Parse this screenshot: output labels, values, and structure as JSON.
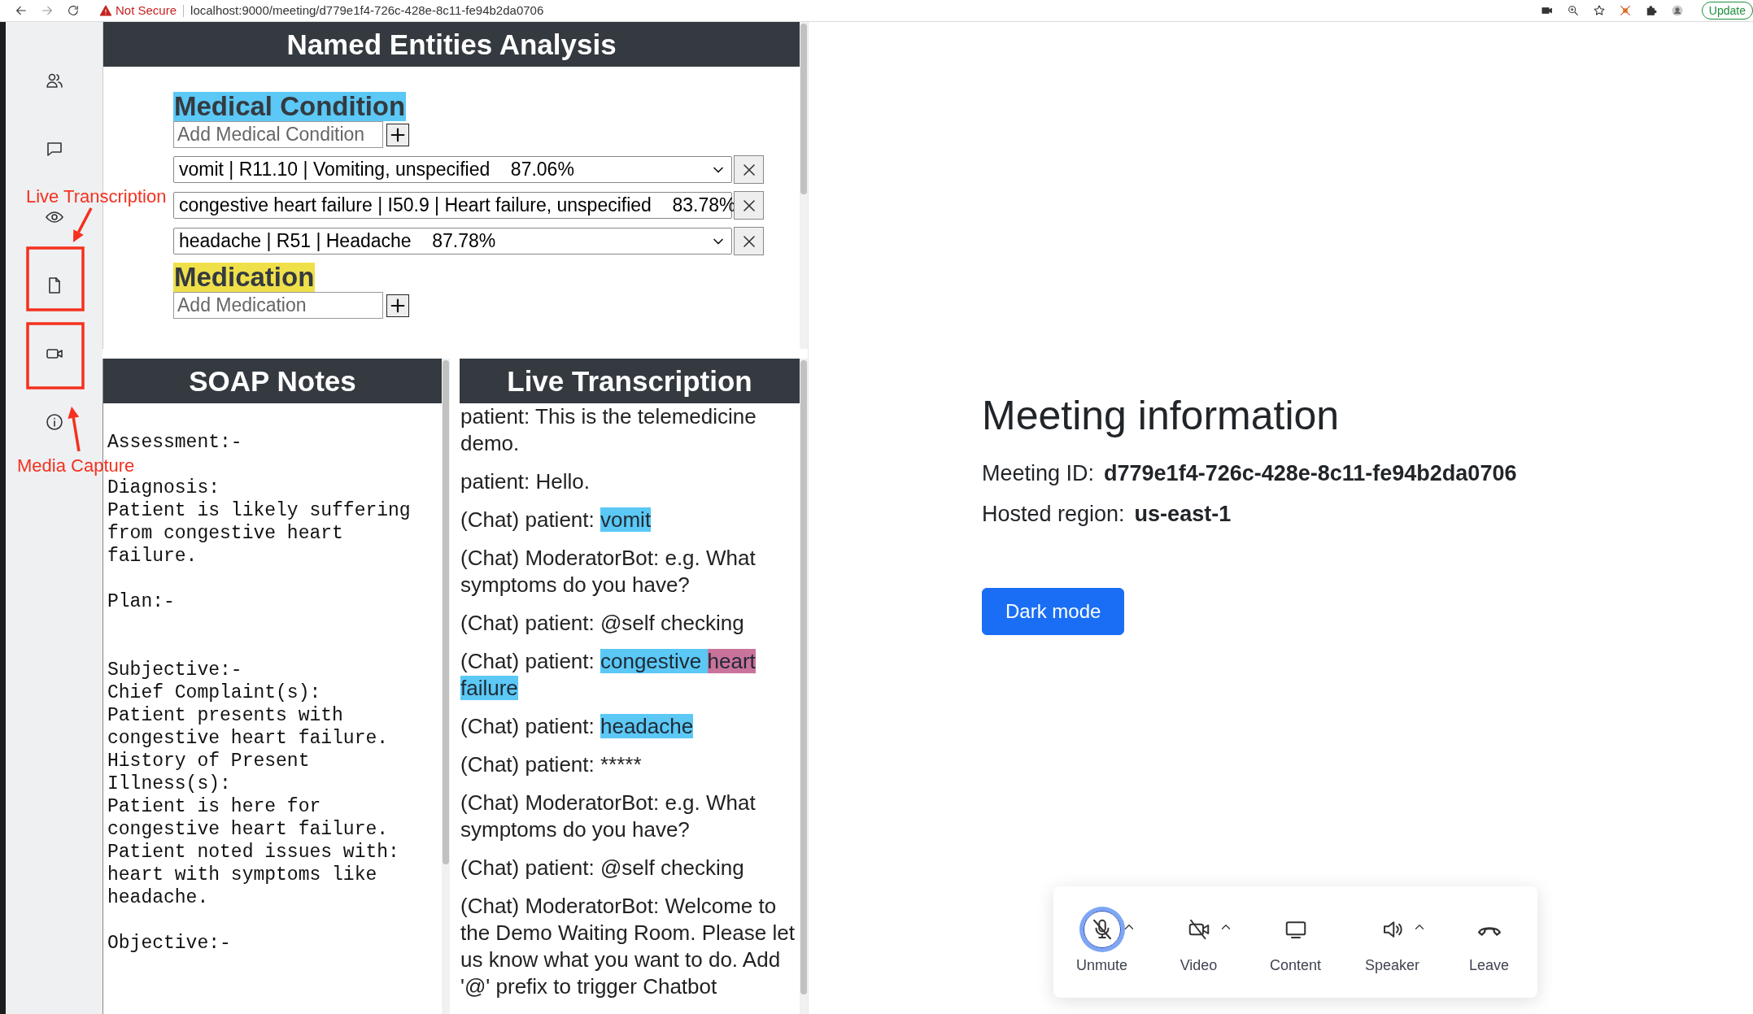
{
  "browser": {
    "security": "Not Secure",
    "url": "localhost:9000/meeting/d779e1f4-726c-428e-8c11-fe94b2da0706",
    "update_button": "Update"
  },
  "annotations": [
    {
      "label": "Live Transcription"
    },
    {
      "label": "Media Capture"
    }
  ],
  "entities": {
    "title": "Named Entities Analysis",
    "sections": [
      {
        "heading": "Medical Condition",
        "color": "#5bc8f5",
        "add_placeholder": "Add Medical Condition",
        "items": [
          {
            "text": "vomit | R11.10 | Vomiting, unspecified    87.06%"
          },
          {
            "text": "congestive heart failure | I50.9 | Heart failure, unspecified    83.78%"
          },
          {
            "text": "headache | R51 | Headache    87.78%"
          }
        ]
      },
      {
        "heading": "Medication",
        "color": "#efe04a",
        "add_placeholder": "Add Medication"
      }
    ]
  },
  "soap": {
    "title": "SOAP Notes",
    "blocks": [
      "Assessment:-",
      "Diagnosis:\nPatient is likely suffering from congestive heart failure.",
      "Plan:-\n\n",
      "Subjective:-\nChief Complaint(s):\nPatient presents with congestive heart failure.\nHistory of Present Illness(s):\nPatient is here for congestive heart failure.\nPatient noted issues with: heart with symptoms like headache.",
      "Objective:-"
    ]
  },
  "transcription": {
    "title": "Live Transcription",
    "messages": [
      {
        "segments": [
          {
            "text": "patient: This is the telemedicine demo."
          }
        ]
      },
      {
        "segments": [
          {
            "text": "patient: Hello."
          }
        ]
      },
      {
        "segments": [
          {
            "text": "(Chat) patient: "
          },
          {
            "text": "vomit",
            "color": "#5bc8f5"
          }
        ]
      },
      {
        "segments": [
          {
            "text": "(Chat) ModeratorBot: e.g. What symptoms do you have?"
          }
        ]
      },
      {
        "segments": [
          {
            "text": "(Chat) patient: @self checking"
          }
        ]
      },
      {
        "segments": [
          {
            "text": "(Chat) patient: "
          },
          {
            "text": "congestive ",
            "color": "#5bc8f5"
          },
          {
            "text": "heart",
            "color": "#c9739b"
          },
          {
            "text": " failure",
            "color": "#5bc8f5"
          }
        ]
      },
      {
        "segments": [
          {
            "text": "(Chat) patient: "
          },
          {
            "text": "headache",
            "color": "#5bc8f5"
          }
        ]
      },
      {
        "segments": [
          {
            "text": "(Chat) patient: *****"
          }
        ]
      },
      {
        "segments": [
          {
            "text": "(Chat) ModeratorBot: e.g. What symptoms do you have?"
          }
        ]
      },
      {
        "segments": [
          {
            "text": "(Chat) patient: @self checking"
          }
        ]
      },
      {
        "segments": [
          {
            "text": "(Chat) ModeratorBot: Welcome to the Demo Waiting Room. Please let us know what you want to do. Add '@' prefix to trigger Chatbot"
          }
        ]
      }
    ]
  },
  "meeting": {
    "title": "Meeting information",
    "fields": [
      {
        "label": "Meeting ID:",
        "value": "d779e1f4-726c-428e-8c11-fe94b2da0706"
      },
      {
        "label": "Hosted region:",
        "value": "us-east-1"
      }
    ],
    "dark_mode_button": "Dark mode"
  },
  "controls": [
    {
      "label": "Unmute",
      "has_menu": true,
      "focused": true
    },
    {
      "label": "Video",
      "has_menu": true,
      "focused": false
    },
    {
      "label": "Content",
      "has_menu": false,
      "focused": false
    },
    {
      "label": "Speaker",
      "has_menu": true,
      "focused": false
    },
    {
      "label": "Leave",
      "has_menu": false,
      "focused": false
    }
  ]
}
